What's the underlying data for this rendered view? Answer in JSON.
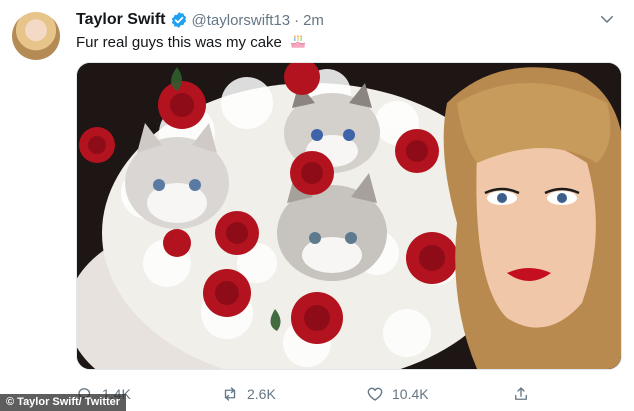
{
  "tweet": {
    "author_name": "Taylor Swift",
    "handle": "@taylorswift13",
    "separator": "·",
    "time": "2m",
    "text": "Fur real guys this was my cake",
    "emoji": "birthday-cake-icon"
  },
  "actions": {
    "replies": "1.4K",
    "retweets": "2.6K",
    "likes": "10.4K"
  },
  "credit": "© Taylor Swift/ Twitter",
  "colors": {
    "verified": "#1da1f2",
    "secondary_text": "#657786",
    "rose": "#b3121f",
    "lipstick": "#c4101e"
  }
}
